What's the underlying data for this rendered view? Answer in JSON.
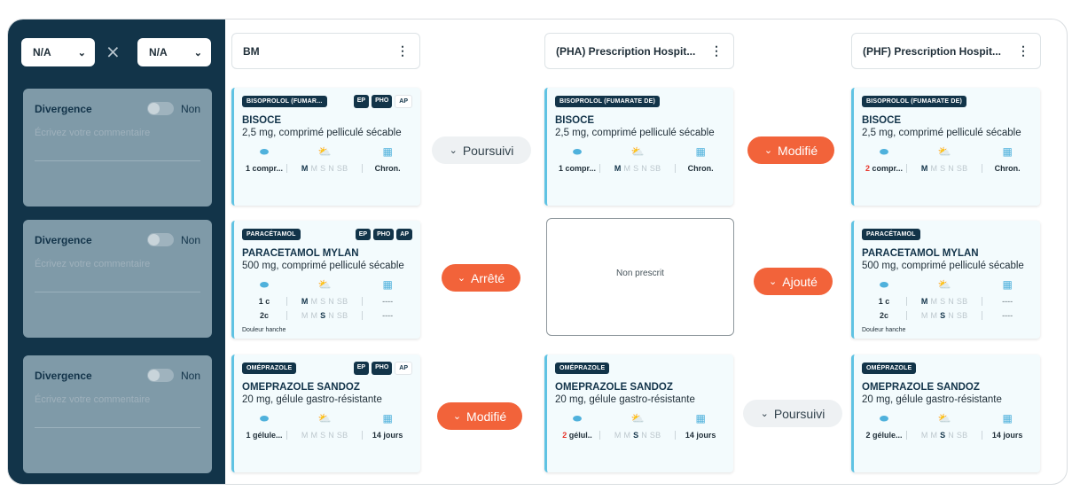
{
  "sidebar": {
    "select_left": "N/A",
    "select_right": "N/A",
    "divergences": [
      {
        "title": "Divergence",
        "toggle": "Non",
        "placeholder": "Écrivez votre commentaire"
      },
      {
        "title": "Divergence",
        "toggle": "Non",
        "placeholder": "Écrivez votre commentaire"
      },
      {
        "title": "Divergence",
        "toggle": "Non",
        "placeholder": "Écrivez votre commentaire"
      }
    ]
  },
  "columns": [
    {
      "title": "BM"
    },
    {
      "title": "(PHA) Prescription Hospit..."
    },
    {
      "title": "(PHF) Prescription Hospit..."
    }
  ],
  "cards": {
    "bm_1": {
      "dci": "BISOPROLOL (FUMAR...",
      "tags": [
        "EP",
        "PHO",
        "AP"
      ],
      "brand": "BISOCE",
      "form": "2,5 mg, comprimé pelliculé sécable",
      "rows": [
        {
          "qty": "1 compr...",
          "sched": [
            "M",
            "M",
            "S",
            "N",
            "SB"
          ],
          "dur": "Chron."
        }
      ]
    },
    "pha_1": {
      "dci": "BISOPROLOL (FUMARATE DE)",
      "brand": "BISOCE",
      "form": "2,5 mg, comprimé pelliculé sécable",
      "rows": [
        {
          "qty": "1 compr...",
          "sched": [
            "M",
            "M",
            "S",
            "N",
            "SB"
          ],
          "dur": "Chron."
        }
      ]
    },
    "phf_1": {
      "dci": "BISOPROLOL (FUMARATE DE)",
      "brand": "BISOCE",
      "form": "2,5 mg, comprimé pelliculé sécable",
      "rows": [
        {
          "qty_red": "2",
          "qty": " compr...",
          "sched": [
            "M",
            "M",
            "S",
            "N",
            "SB"
          ],
          "dur": "Chron."
        }
      ]
    },
    "bm_2": {
      "dci": "PARACÉTAMOL",
      "tags": [
        "EP",
        "PHO",
        "AP"
      ],
      "brand": "PARACETAMOL MYLAN",
      "form": "500 mg, comprimé pelliculé sécable",
      "rows": [
        {
          "qty": "1 c",
          "sched": [
            "M",
            "M",
            "S",
            "N",
            "SB"
          ],
          "dur": "----"
        },
        {
          "qty": "2c",
          "sched": [
            "M",
            "M",
            "S",
            "N",
            "SB"
          ],
          "dur": "----"
        }
      ],
      "note": "Douleur hanche"
    },
    "pha_2": {
      "empty": "Non prescrit"
    },
    "phf_2": {
      "dci": "PARACÉTAMOL",
      "brand": "PARACETAMOL MYLAN",
      "form": "500 mg, comprimé pelliculé sécable",
      "rows": [
        {
          "qty": "1 c",
          "sched": [
            "M",
            "M",
            "S",
            "N",
            "SB"
          ],
          "dur": "----"
        },
        {
          "qty": "2c",
          "sched": [
            "M",
            "M",
            "S",
            "N",
            "SB"
          ],
          "dur": "----"
        }
      ],
      "note": "Douleur hanche"
    },
    "bm_3": {
      "dci": "OMÉPRAZOLE",
      "tags": [
        "EP",
        "PHO",
        "AP"
      ],
      "brand": "OMEPRAZOLE SANDOZ",
      "form": "20 mg, gélule gastro-résistante",
      "rows": [
        {
          "qty": "1 gélule...",
          "sched": [
            "M",
            "M",
            "S",
            "N",
            "SB"
          ],
          "dur": "14 jours"
        }
      ]
    },
    "pha_3": {
      "dci": "OMÉPRAZOLE",
      "brand": "OMEPRAZOLE SANDOZ",
      "form": "20 mg, gélule gastro-résistante",
      "rows": [
        {
          "qty_red": "2",
          "qty": " gélul..",
          "sched": [
            "M",
            "M",
            "S",
            "N",
            "SB"
          ],
          "dur": "14 jours"
        }
      ]
    },
    "phf_3": {
      "dci": "OMÉPRAZOLE",
      "brand": "OMEPRAZOLE SANDOZ",
      "form": "20 mg, gélule gastro-résistante",
      "rows": [
        {
          "qty": "2 gélule...",
          "sched": [
            "M",
            "M",
            "S",
            "N",
            "SB"
          ],
          "dur": "14 jours"
        }
      ]
    }
  },
  "statuses": {
    "r1_bm_pha": "Poursuivi",
    "r1_pha_phf": "Modifié",
    "r2_bm_pha": "Arrêté",
    "r2_pha_phf": "Ajouté",
    "r3_bm_pha": "Modifié",
    "r3_pha_phf": "Poursuivi"
  },
  "colors": {
    "navy": "#123449",
    "orange": "#f2633a",
    "accent_blue": "#5fc3e3",
    "red": "#e8352b"
  }
}
